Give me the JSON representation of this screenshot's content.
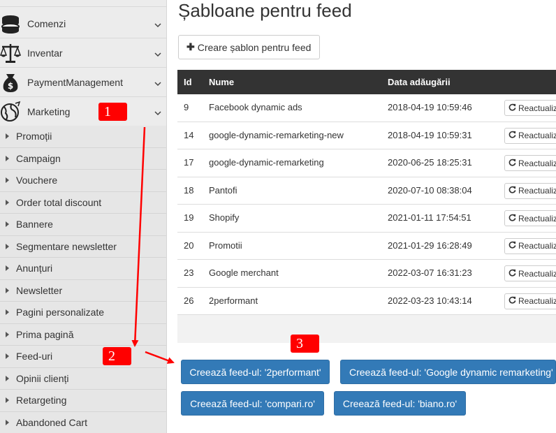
{
  "sidebar": {
    "items": [
      {
        "label": "",
        "icon": "top-cropped-icon"
      },
      {
        "label": "Comenzi",
        "icon": "coins-icon"
      },
      {
        "label": "Inventar",
        "icon": "scales-icon"
      },
      {
        "label": "PaymentManagement",
        "icon": "money-bag-icon"
      },
      {
        "label": "Marketing",
        "icon": "globe-icon"
      }
    ],
    "submenu": [
      "Promoții",
      "Campaign",
      "Vouchere",
      "Order total discount",
      "Bannere",
      "Segmentare newsletter",
      "Anunțuri",
      "Newsletter",
      "Pagini personalizate",
      "Prima pagină",
      "Feed-uri",
      "Opinii clienți",
      "Retargeting",
      "Abandoned Cart"
    ]
  },
  "main": {
    "title": "Șabloane pentru feed",
    "create_button": "Creare șablon pentru feed",
    "table": {
      "headers": [
        "Id",
        "Nume",
        "Data adăugării"
      ],
      "action_label": "Reactualiz",
      "rows": [
        {
          "id": "9",
          "name": "Facebook dynamic ads",
          "date": "2018-04-19 10:59:46"
        },
        {
          "id": "14",
          "name": "google-dynamic-remarketing-new",
          "date": "2018-04-19 10:59:31"
        },
        {
          "id": "17",
          "name": "google-dynamic-remarketing",
          "date": "2020-06-25 18:25:31"
        },
        {
          "id": "18",
          "name": "Pantofi",
          "date": "2020-07-10 08:38:04"
        },
        {
          "id": "19",
          "name": "Shopify",
          "date": "2021-01-11 17:54:51"
        },
        {
          "id": "20",
          "name": "Promotii",
          "date": "2021-01-29 16:28:49"
        },
        {
          "id": "23",
          "name": "Google merchant",
          "date": "2022-03-07 16:31:23"
        },
        {
          "id": "26",
          "name": "2performant",
          "date": "2022-03-23 10:43:14"
        }
      ]
    },
    "feed_buttons": [
      "Creează feed-ul: '2performant'",
      "Creează feed-ul: 'Google dynamic remarketing'",
      "Creează feed-ul: 'compari.ro'",
      "Creează feed-ul: 'biano.ro'"
    ]
  },
  "annotations": {
    "badges": [
      "1",
      "2",
      "3"
    ],
    "color": "#ff0000"
  },
  "colors": {
    "primary": "#337ab7",
    "table_header": "#333333",
    "sidebar_bg": "#ececec"
  }
}
